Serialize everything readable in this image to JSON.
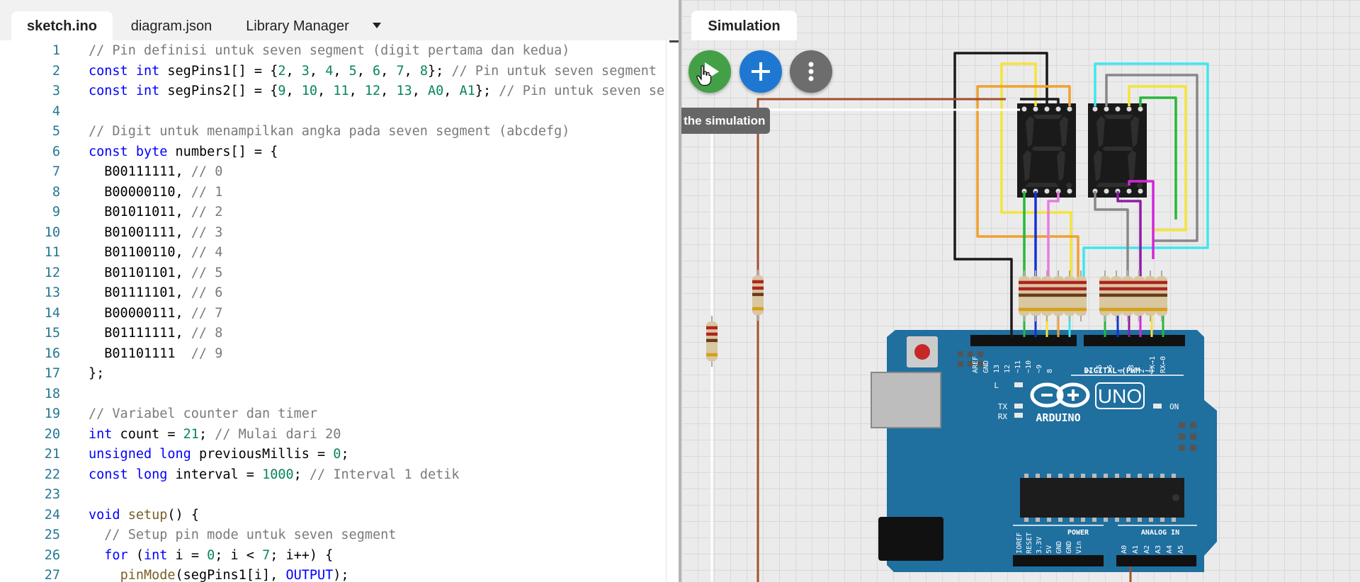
{
  "editor": {
    "tabs": [
      {
        "label": "sketch.ino",
        "active": true
      },
      {
        "label": "diagram.json",
        "active": false
      },
      {
        "label": "Library Manager",
        "active": false
      }
    ],
    "lines": [
      {
        "n": "1",
        "t": "// Pin definisi untuk seven segment (digit pertama dan kedua)"
      },
      {
        "n": "2",
        "t": "const int segPins1[] = {2, 3, 4, 5, 6, 7, 8}; // Pin untuk seven segment"
      },
      {
        "n": "3",
        "t": "const int segPins2[] = {9, 10, 11, 12, 13, A0, A1}; // Pin untuk seven se"
      },
      {
        "n": "4",
        "t": ""
      },
      {
        "n": "5",
        "t": "// Digit untuk menampilkan angka pada seven segment (abcdefg)"
      },
      {
        "n": "6",
        "t": "const byte numbers[] = {"
      },
      {
        "n": "7",
        "t": "  B00111111, // 0"
      },
      {
        "n": "8",
        "t": "  B00000110, // 1"
      },
      {
        "n": "9",
        "t": "  B01011011, // 2"
      },
      {
        "n": "10",
        "t": "  B01001111, // 3"
      },
      {
        "n": "11",
        "t": "  B01100110, // 4"
      },
      {
        "n": "12",
        "t": "  B01101101, // 5"
      },
      {
        "n": "13",
        "t": "  B01111101, // 6"
      },
      {
        "n": "14",
        "t": "  B00000111, // 7"
      },
      {
        "n": "15",
        "t": "  B01111111, // 8"
      },
      {
        "n": "16",
        "t": "  B01101111  // 9"
      },
      {
        "n": "17",
        "t": "};"
      },
      {
        "n": "18",
        "t": ""
      },
      {
        "n": "19",
        "t": "// Variabel counter dan timer"
      },
      {
        "n": "20",
        "t": "int count = 21; // Mulai dari 20"
      },
      {
        "n": "21",
        "t": "unsigned long previousMillis = 0;"
      },
      {
        "n": "22",
        "t": "const long interval = 1000; // Interval 1 detik"
      },
      {
        "n": "23",
        "t": ""
      },
      {
        "n": "24",
        "t": "void setup() {"
      },
      {
        "n": "25",
        "t": "  // Setup pin mode untuk seven segment"
      },
      {
        "n": "26",
        "t": "  for (int i = 0; i < 7; i++) {"
      },
      {
        "n": "27",
        "t": "    pinMode(segPins1[i], OUTPUT);"
      }
    ]
  },
  "simulation": {
    "tab_label": "Simulation",
    "tooltip": "Start the simulation",
    "buttons": {
      "start_icon": "play-icon",
      "add_icon": "plus-icon",
      "more_icon": "more-vert-icon"
    },
    "board": {
      "model_label": "UNO",
      "brand_label": "ARDUINO",
      "on_label": "ON",
      "led_labels": [
        "L",
        "TX",
        "RX"
      ],
      "digital_label": "DIGITAL (PWM ~)",
      "power_label": "POWER",
      "analog_label": "ANALOG IN",
      "digital_pins": [
        "AREF",
        "GND",
        "13",
        "12",
        "~11",
        "~10",
        "~9",
        "8",
        "7",
        "~6",
        "~5",
        "4",
        "~3",
        "2",
        "TX→1",
        "RX←0"
      ],
      "power_pins": [
        "IOREF",
        "RESET",
        "3.3V",
        "5V",
        "GND",
        "GND",
        "Vin"
      ],
      "analog_pins": [
        "A0",
        "A1",
        "A2",
        "A3",
        "A4",
        "A5"
      ]
    },
    "colors": {
      "board": "#1f6f9f",
      "display_body": "#1a1a1a",
      "display_segment_off": "#2e2e2e",
      "wire_black": "#1a1a1a",
      "wire_yellow": "#f5e33a",
      "wire_orange": "#f0a030",
      "wire_cyan": "#3fe7ef",
      "wire_gray": "#888888",
      "wire_green": "#27b83a",
      "wire_blue": "#1232d6",
      "wire_pink": "#e87be0",
      "wire_purple": "#8e1ea3",
      "wire_magenta": "#d426d8",
      "wire_brown": "#a0522d",
      "play_button": "#43a047",
      "add_button": "#1e78d2",
      "more_button": "#6d6d6d"
    }
  }
}
